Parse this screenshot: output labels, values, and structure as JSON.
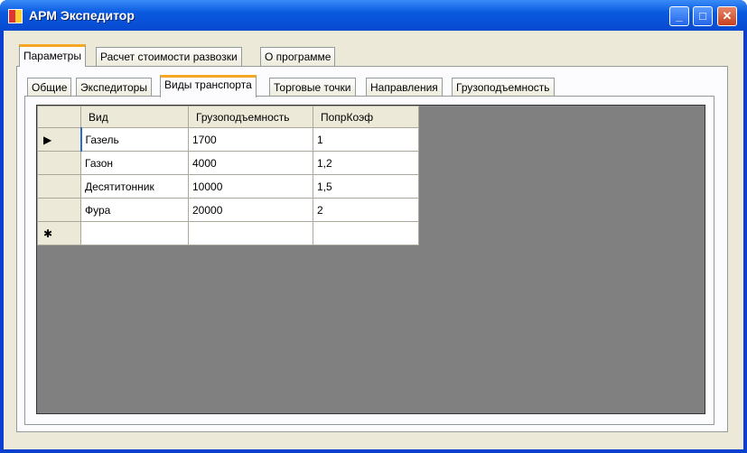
{
  "window": {
    "title": "АРМ Экспедитор",
    "minimize": "_",
    "maximize": "□",
    "close": "✕"
  },
  "outer_tabs": [
    "Параметры",
    "Расчет стоимости развозки",
    "О программе"
  ],
  "inner_tabs": [
    "Общие",
    "Экспедиторы",
    "Виды транспорта",
    "Торговые точки",
    "Направления",
    "Грузоподъемность"
  ],
  "grid": {
    "columns": [
      "Вид",
      "Грузоподъемность",
      "ПопрКоэф"
    ],
    "rows": [
      [
        "Газель",
        "1700",
        "1"
      ],
      [
        "Газон",
        "4000",
        "1,2"
      ],
      [
        "Десятитонник",
        "10000",
        "1,5"
      ],
      [
        "Фура",
        "20000",
        "2"
      ]
    ],
    "current_row_marker": "▶",
    "new_row_marker": "✱"
  }
}
